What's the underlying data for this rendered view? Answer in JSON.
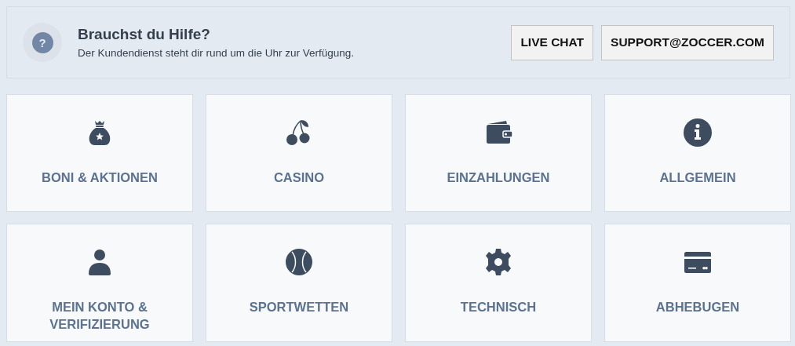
{
  "help_banner": {
    "title": "Brauchst du Hilfe?",
    "subtitle": "Der Kundendienst steht dir rund um die Uhr zur Verfügung.",
    "icon_glyph": "?",
    "buttons": [
      "LIVE CHAT",
      "SUPPORT@ZOCCER.COM"
    ]
  },
  "categories": [
    {
      "label": "BONI & AKTIONEN"
    },
    {
      "label": "CASINO"
    },
    {
      "label": "EINZAHLUNGEN"
    },
    {
      "label": "ALLGEMEIN"
    },
    {
      "label": "MEIN KONTO & VERIFIZIERUNG"
    },
    {
      "label": "SPORTWETTEN"
    },
    {
      "label": "TECHNISCH"
    },
    {
      "label": "ABHEBUGEN"
    }
  ]
}
